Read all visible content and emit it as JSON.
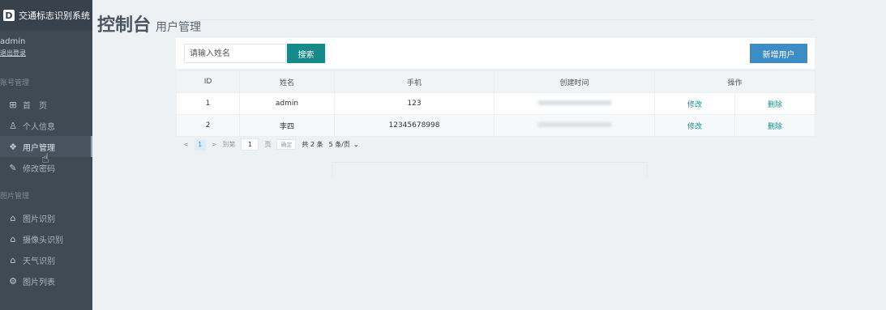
{
  "brand": {
    "logo": "D",
    "title": "交通标志识别系统"
  },
  "user": {
    "name": "admin",
    "logout": "退出登录"
  },
  "sidebar": {
    "section1": "账号管理",
    "section2": "图片管理",
    "items": [
      {
        "label": "首　页",
        "icon": "home-icon",
        "glyph": "⊞"
      },
      {
        "label": "个人信息",
        "icon": "person-icon",
        "glyph": "♙"
      },
      {
        "label": "用户管理",
        "icon": "users-icon",
        "glyph": "❖"
      },
      {
        "label": "修改密码",
        "icon": "pencil-icon",
        "glyph": "✎"
      },
      {
        "label": "图片识别",
        "icon": "bank-icon",
        "glyph": "⌂"
      },
      {
        "label": "摄像头识别",
        "icon": "bank-icon",
        "glyph": "⌂"
      },
      {
        "label": "天气识别",
        "icon": "bank-icon",
        "glyph": "⌂"
      },
      {
        "label": "图片列表",
        "icon": "gear-icon",
        "glyph": "⚙"
      }
    ],
    "active_index": 2
  },
  "header": {
    "title": "控制台",
    "subtitle": "用户管理"
  },
  "toolbar": {
    "search_placeholder": "请输入姓名",
    "search_value": "",
    "search_label": "搜索",
    "add_label": "新增用户"
  },
  "table": {
    "columns": [
      "ID",
      "姓名",
      "手机",
      "创建时间",
      "操作"
    ],
    "rows": [
      {
        "id": "1",
        "name": "admin",
        "phone": "123",
        "created": "",
        "edit": "修改",
        "delete": "删除"
      },
      {
        "id": "2",
        "name": "李四",
        "phone": "12345678998",
        "created": "",
        "edit": "修改",
        "delete": "删除"
      }
    ]
  },
  "pagination": {
    "prev": "<",
    "current": "1",
    "next": ">",
    "goto_label": "到第",
    "goto_value": "1",
    "page_unit": "页",
    "confirm": "确定",
    "total": "共 2 条",
    "page_size": "5 条/页"
  },
  "colors": {
    "sidebar_bg": "#3f4a55",
    "search_button": "#168a8a",
    "add_button": "#3c8dc6",
    "link": "#168a8a"
  }
}
